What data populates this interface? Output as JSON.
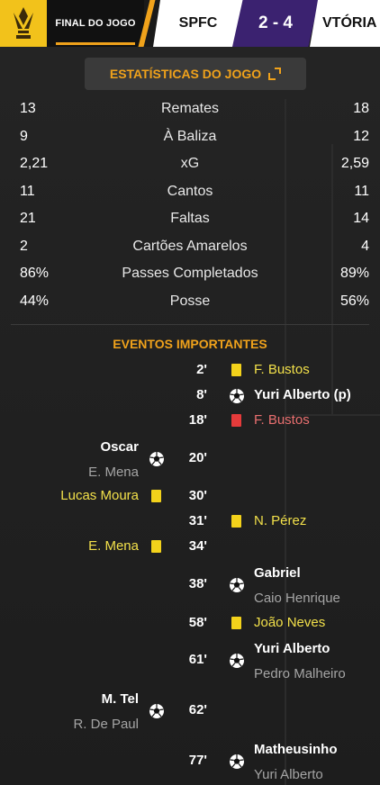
{
  "header": {
    "status": "FINAL DO JOGO",
    "home_team": "SPFC",
    "score": "2 - 4",
    "away_team": "VTÓRIA"
  },
  "stats": {
    "title": "ESTATÍSTICAS DO JOGO",
    "rows": [
      {
        "home": "13",
        "label": "Remates",
        "away": "18"
      },
      {
        "home": "9",
        "label": "À Baliza",
        "away": "12"
      },
      {
        "home": "2,21",
        "label": "xG",
        "away": "2,59"
      },
      {
        "home": "11",
        "label": "Cantos",
        "away": "11"
      },
      {
        "home": "21",
        "label": "Faltas",
        "away": "14"
      },
      {
        "home": "2",
        "label": "Cartões Amarelos",
        "away": "4"
      },
      {
        "home": "86%",
        "label": "Passes Completados",
        "away": "89%"
      },
      {
        "home": "44%",
        "label": "Posse",
        "away": "56%"
      }
    ]
  },
  "events": {
    "title": "EVENTOS IMPORTANTES",
    "items": [
      {
        "minute": "2'",
        "side": "away",
        "type": "yellow-card",
        "player": "F. Bustos"
      },
      {
        "minute": "8'",
        "side": "away",
        "type": "goal",
        "player": "Yuri Alberto (p)"
      },
      {
        "minute": "18'",
        "side": "away",
        "type": "red-card",
        "player": "F. Bustos"
      },
      {
        "minute": "20'",
        "side": "home",
        "type": "goal",
        "player": "Oscar",
        "assist": "E. Mena"
      },
      {
        "minute": "30'",
        "side": "home",
        "type": "yellow-card",
        "player": "Lucas Moura"
      },
      {
        "minute": "31'",
        "side": "away",
        "type": "yellow-card",
        "player": "N. Pérez"
      },
      {
        "minute": "34'",
        "side": "home",
        "type": "yellow-card",
        "player": "E. Mena"
      },
      {
        "minute": "38'",
        "side": "away",
        "type": "goal",
        "player": "Gabriel",
        "assist": "Caio Henrique"
      },
      {
        "minute": "58'",
        "side": "away",
        "type": "yellow-card",
        "player": "João Neves"
      },
      {
        "minute": "61'",
        "side": "away",
        "type": "goal",
        "player": "Yuri Alberto",
        "assist": "Pedro Malheiro"
      },
      {
        "minute": "62'",
        "side": "home",
        "type": "goal",
        "player": "M. Tel",
        "assist": "R. De Paul"
      },
      {
        "minute": "77'",
        "side": "away",
        "type": "goal",
        "player": "Matheusinho",
        "assist": "Yuri Alberto"
      }
    ]
  },
  "colors": {
    "accent": "#f0a21b",
    "logo_bg": "#f2c21b",
    "score_bg": "#3b2270",
    "yellow_card": "#f3d21b",
    "red_card": "#e53b3b",
    "yellow_text": "#f2e04a",
    "red_text": "#e96f6f"
  },
  "icons": {
    "logo": "league-trophy-icon",
    "expand": "expand-icon",
    "goal": "football-icon",
    "yellow": "yellow-card-icon",
    "red": "red-card-icon"
  }
}
